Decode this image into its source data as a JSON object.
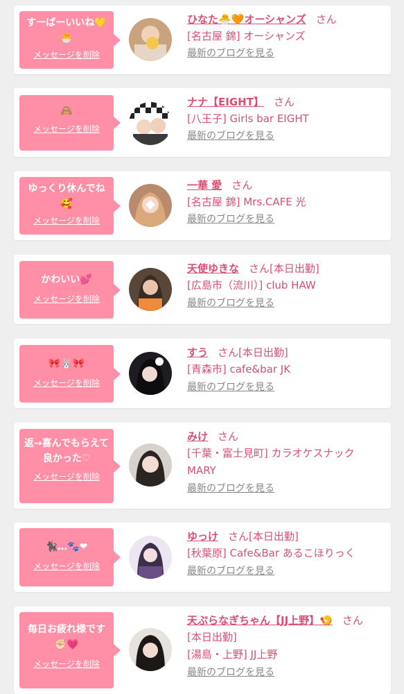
{
  "common": {
    "delete_label": "メッセージを削除",
    "blog_label": "最新のブログを見る",
    "san_label": "さん",
    "today_label": "[本日出勤]"
  },
  "colors": {
    "page_bg": "#efefef",
    "card_bg": "#ffffff",
    "bubble_bg": "#ff8fa6",
    "accent": "#d94f72",
    "blog_link": "#888888"
  },
  "items": [
    {
      "message": "すーぱーいいね💛🐣",
      "name": "ひなた🐣🧡オーシャンズ",
      "today": "",
      "shop": "[名古屋 錦] オーシャンズ",
      "avatar_icon": "avatar-photo"
    },
    {
      "message": "🙈",
      "name": "ナナ【EIGHT】",
      "today": "",
      "shop": "[八王子] Girls bar EIGHT",
      "avatar_icon": "avatar-photo"
    },
    {
      "message": "ゆっくり休んでね🥰",
      "name": "一華 愛",
      "today": "",
      "shop": "[名古屋 錦] Mrs.CAFE 光",
      "avatar_icon": "avatar-photo"
    },
    {
      "message": "かわいい💕",
      "name": "天使ゆきな",
      "today": "[本日出勤]",
      "shop": "[広島市（流川）] club HAW",
      "avatar_icon": "avatar-photo"
    },
    {
      "message": "🎀🐰🎀",
      "name": "すう",
      "today": "[本日出勤]",
      "shop": "[青森市] cafe&bar JK",
      "avatar_icon": "avatar-photo"
    },
    {
      "message": "返→喜んでもらえて良かった♡",
      "name": "みけ",
      "today": "",
      "shop": "[千葉・富士見町] カラオケスナック MARY",
      "avatar_icon": "avatar-photo"
    },
    {
      "message": "🐈‍⬛…🐾❤",
      "name": "ゆっけ",
      "today": "[本日出勤]",
      "shop": "[秋葉原] Cafe&Bar あるこほりっく",
      "avatar_icon": "avatar-photo"
    },
    {
      "message": "毎日お疲れ様です✊🏻💗",
      "name": "天ぷらなぎちゃん【JJ上野】🍤",
      "today": "[本日出勤]",
      "shop": "[湯島・上野] JJ上野",
      "avatar_icon": "avatar-photo"
    }
  ]
}
